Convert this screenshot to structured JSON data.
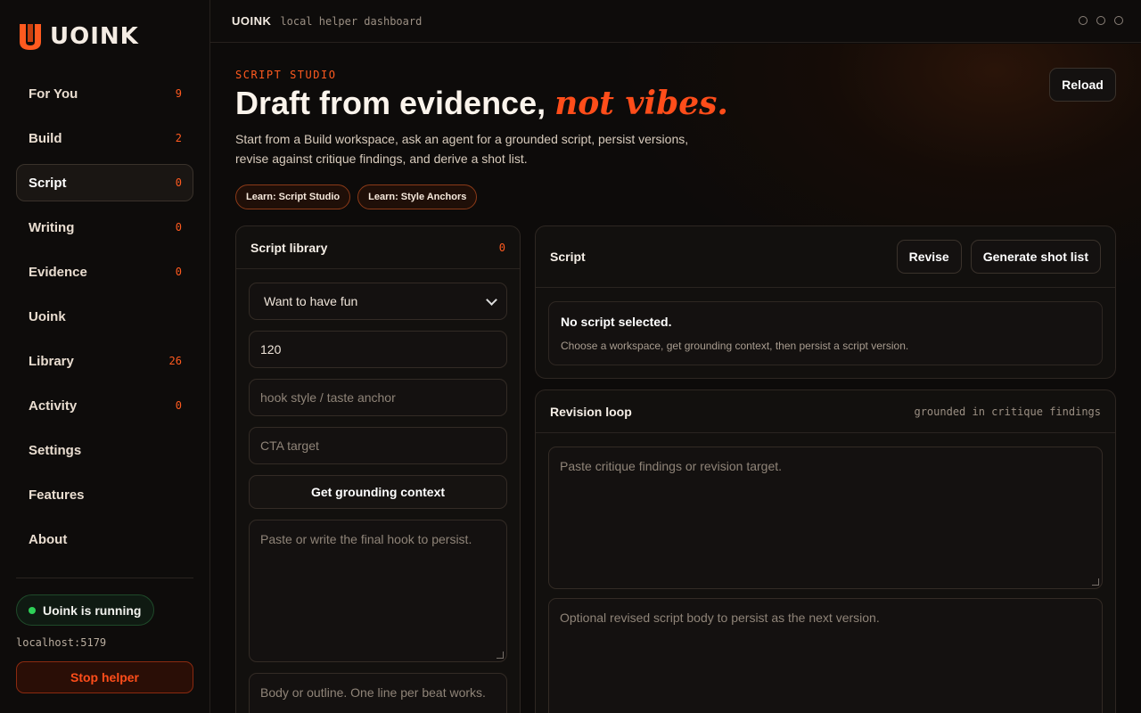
{
  "app": {
    "brand": "UOINK",
    "subtitle": "local helper dashboard",
    "accent_color": "#ff5a1f"
  },
  "sidebar": {
    "items": [
      {
        "label": "For You",
        "count": "9"
      },
      {
        "label": "Build",
        "count": "2"
      },
      {
        "label": "Script",
        "count": "0"
      },
      {
        "label": "Writing",
        "count": "0"
      },
      {
        "label": "Evidence",
        "count": "0"
      },
      {
        "label": "Uoink",
        "count": ""
      },
      {
        "label": "Library",
        "count": "26"
      },
      {
        "label": "Activity",
        "count": "0"
      },
      {
        "label": "Settings",
        "count": ""
      },
      {
        "label": "Features",
        "count": ""
      },
      {
        "label": "About",
        "count": ""
      }
    ],
    "active": "Script",
    "status": "Uoink is running",
    "host": "localhost:5179",
    "stop_label": "Stop helper"
  },
  "header": {
    "eyebrow": "SCRIPT STUDIO",
    "headline_main": "Draft from evidence,",
    "headline_accent": "not vibes.",
    "intro": "Start from a Build workspace, ask an agent for a grounded script, persist versions, revise against critique findings, and derive a shot list.",
    "reload_label": "Reload",
    "chips": [
      "Learn: Script Studio",
      "Learn: Style Anchors"
    ]
  },
  "library": {
    "title": "Script library",
    "count": "0",
    "workspace_selected": "Want to have fun",
    "duration_value": "120",
    "hook_placeholder": "hook style / taste anchor",
    "cta_placeholder": "CTA target",
    "ground_button": "Get grounding context",
    "final_hook_placeholder": "Paste or write the final hook to persist.",
    "body_placeholder": "Body or outline. One line per beat works."
  },
  "script": {
    "title": "Script",
    "revise_label": "Revise",
    "shotlist_label": "Generate shot list",
    "empty_title": "No script selected.",
    "empty_sub": "Choose a workspace, get grounding context, then persist a script version."
  },
  "revision": {
    "title": "Revision loop",
    "note": "grounded in critique findings",
    "critique_placeholder": "Paste critique findings or revision target.",
    "revised_placeholder": "Optional revised script body to persist as the next version."
  }
}
